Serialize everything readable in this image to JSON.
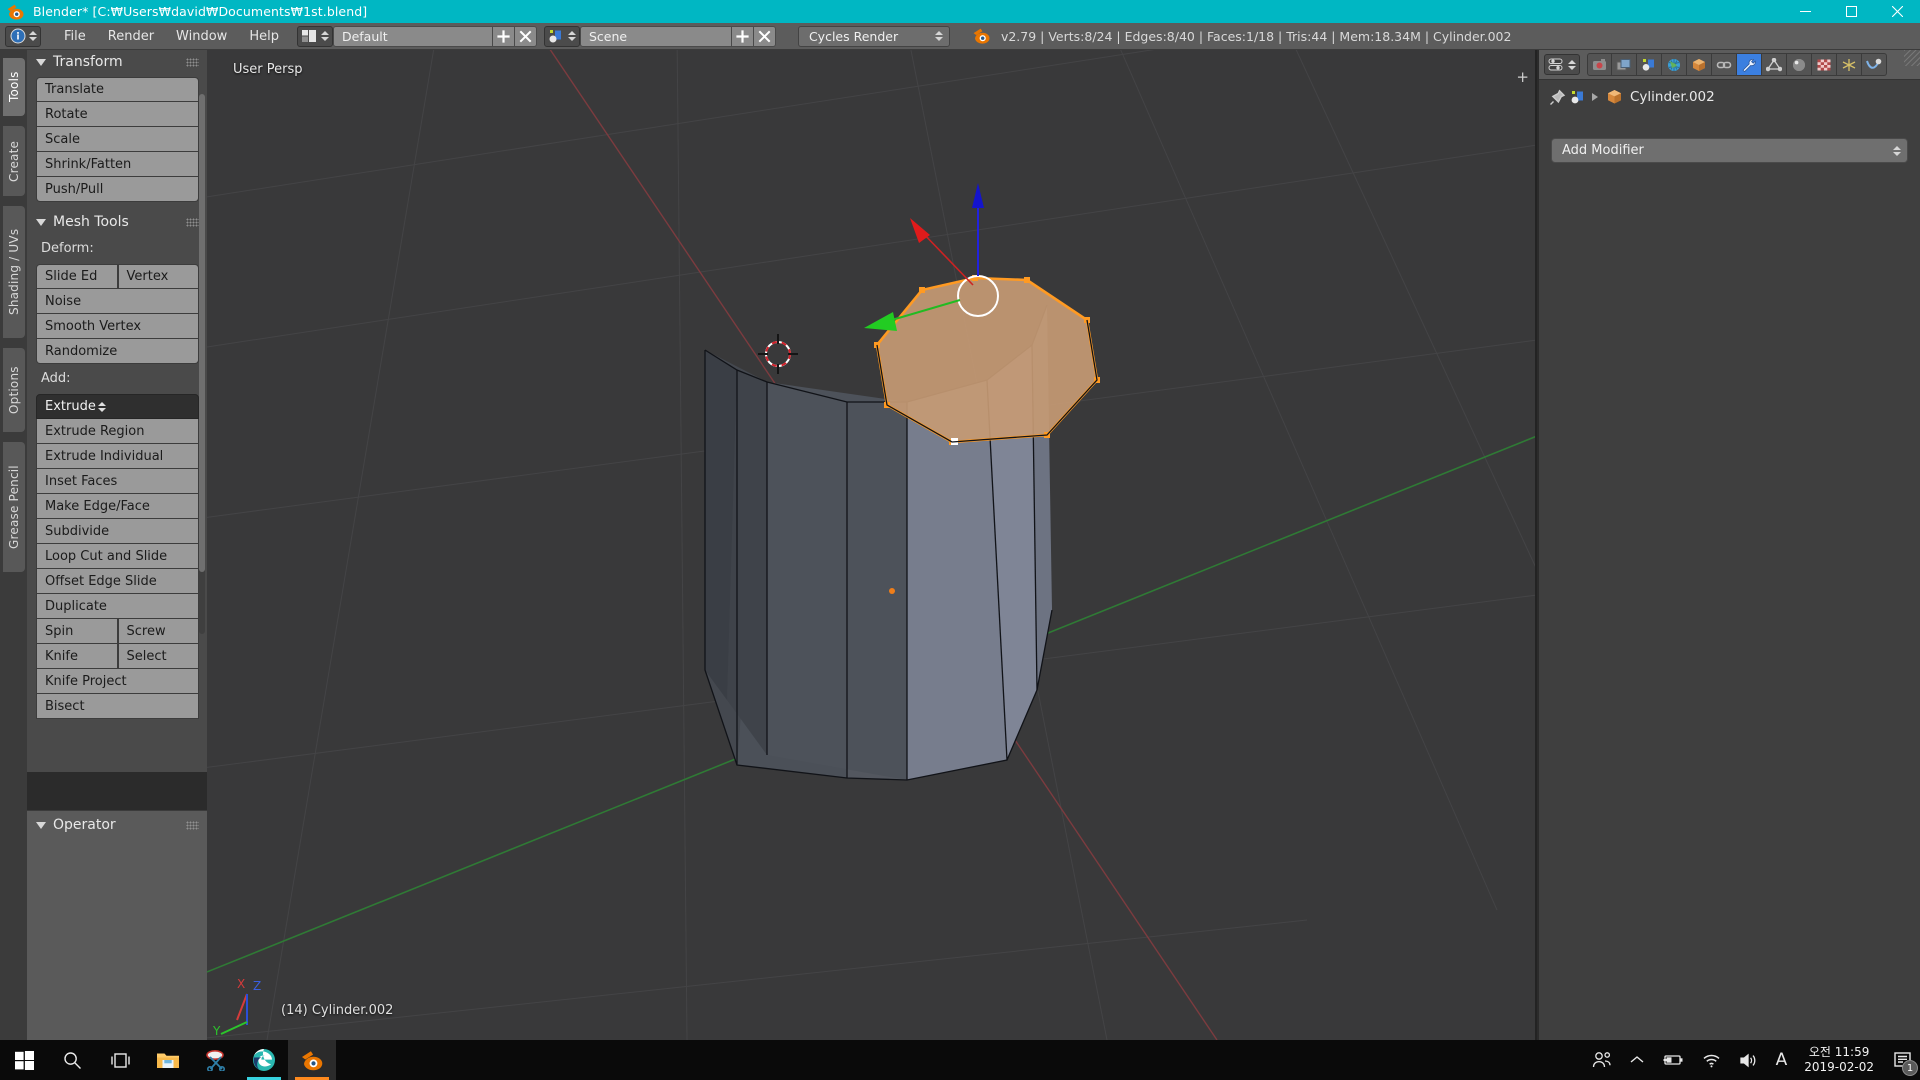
{
  "window": {
    "title": "Blender* [C:\\Users\\david\\Documents\\1st.blend]",
    "title_display": "Blender* [C:₩Users₩david₩Documents₩1st.blend]",
    "minimize": "minimize-button",
    "maximize": "maximize-button",
    "close": "close-button",
    "accent_color": "#00b7c3"
  },
  "topbar": {
    "editor_icon": "info-editor-icon",
    "menus": [
      "File",
      "Render",
      "Window",
      "Help"
    ],
    "layout": {
      "icon": "screen-layout-icon",
      "value": "Default",
      "add": "+",
      "remove": "x"
    },
    "scene": {
      "icon": "scene-icon",
      "value": "Scene",
      "add": "+",
      "remove": "x"
    },
    "engine": {
      "value": "Cycles Render"
    },
    "logo": "blender-logo-icon",
    "stats": "v2.79 | Verts:8/24 | Edges:8/40 | Faces:1/18 | Tris:44 | Mem:18.34M | Cylinder.002"
  },
  "toolshelf": {
    "tabs": [
      {
        "label": "Tools",
        "active": true
      },
      {
        "label": "Create",
        "active": false
      },
      {
        "label": "Shading / UVs",
        "active": false
      },
      {
        "label": "Options",
        "active": false
      },
      {
        "label": "Grease Pencil",
        "active": false
      }
    ],
    "transform": {
      "title": "Transform",
      "buttons": [
        "Translate",
        "Rotate",
        "Scale",
        "Shrink/Fatten",
        "Push/Pull"
      ]
    },
    "mesh_tools": {
      "title": "Mesh Tools",
      "deform_label": "Deform:",
      "deform_pair": [
        "Slide Ed",
        "Vertex"
      ],
      "deform_buttons": [
        "Noise",
        "Smooth Vertex",
        "Randomize"
      ],
      "add_label": "Add:",
      "add_enum": "Extrude",
      "add_buttons": [
        "Extrude Region",
        "Extrude Individual",
        "Inset Faces",
        "Make Edge/Face",
        "Subdivide",
        "Loop Cut and Slide",
        "Offset Edge Slide",
        "Duplicate"
      ],
      "pair_spin": [
        "Spin",
        "Screw"
      ],
      "pair_knife": [
        "Knife",
        "Select"
      ],
      "tail_buttons": [
        "Knife Project",
        "Bisect"
      ]
    },
    "operator": {
      "title": "Operator"
    }
  },
  "viewport": {
    "view_label": "User Persp",
    "object_label": "(14) Cylinder.002",
    "axis_gizmo": {
      "x": "X",
      "y": "Y",
      "z": "Z"
    },
    "colors": {
      "background": "#39393a",
      "selected_face": "#c99b72",
      "selected_edge": "#ff9a22",
      "mesh_dark": "#4a4f57",
      "mesh_mid": "#5a5f68",
      "mesh_light": "#7d8394",
      "grid_line": "#4a4a4c",
      "axis_x": "#8c3b3b",
      "axis_y": "#3b8c3b",
      "manip_x": "#ee2222",
      "manip_y": "#22cc22",
      "manip_z": "#2222ee"
    }
  },
  "properties": {
    "editor_icon": "properties-editor-icon",
    "tabs": [
      {
        "name": "render-tab",
        "icon": "camera-icon",
        "active": false
      },
      {
        "name": "render-layers-tab",
        "icon": "images-icon",
        "active": false
      },
      {
        "name": "scene-tab",
        "icon": "scene-icon",
        "active": false
      },
      {
        "name": "world-tab",
        "icon": "globe-icon",
        "active": false
      },
      {
        "name": "object-tab",
        "icon": "cube-icon",
        "active": false
      },
      {
        "name": "constraints-tab",
        "icon": "chain-icon",
        "active": false
      },
      {
        "name": "modifiers-tab",
        "icon": "wrench-icon",
        "active": true
      },
      {
        "name": "data-tab",
        "icon": "triangle-mesh-icon",
        "active": false
      },
      {
        "name": "material-tab",
        "icon": "sphere-icon",
        "active": false
      },
      {
        "name": "texture-tab",
        "icon": "checker-icon",
        "active": false
      },
      {
        "name": "particles-tab",
        "icon": "particles-icon",
        "active": false
      },
      {
        "name": "physics-tab",
        "icon": "physics-icon",
        "active": false
      }
    ],
    "breadcrumb": {
      "pin": "pin-icon",
      "scene_icon": "scene-icon",
      "object_icon": "object-cube-icon",
      "object_name": "Cylinder.002"
    },
    "add_modifier": "Add Modifier"
  },
  "taskbar": {
    "items": [
      {
        "name": "start-button",
        "icon": "windows-logo-icon"
      },
      {
        "name": "search-button",
        "icon": "search-icon"
      },
      {
        "name": "task-view-button",
        "icon": "task-view-icon"
      },
      {
        "name": "file-explorer-button",
        "icon": "folder-icon"
      },
      {
        "name": "snipping-tool-button",
        "icon": "scissors-icon"
      },
      {
        "name": "edge-browser-button",
        "icon": "edge-icon"
      },
      {
        "name": "blender-taskbar-button",
        "icon": "blender-logo-icon"
      }
    ],
    "tray": {
      "people": "people-icon",
      "chevron": "show-hidden-icons-icon",
      "battery": "battery-icon",
      "wifi": "wifi-icon",
      "volume": "volume-icon",
      "ime": "A",
      "time": "오전 11:59",
      "date": "2019-02-02",
      "notifications_count": "1"
    }
  }
}
